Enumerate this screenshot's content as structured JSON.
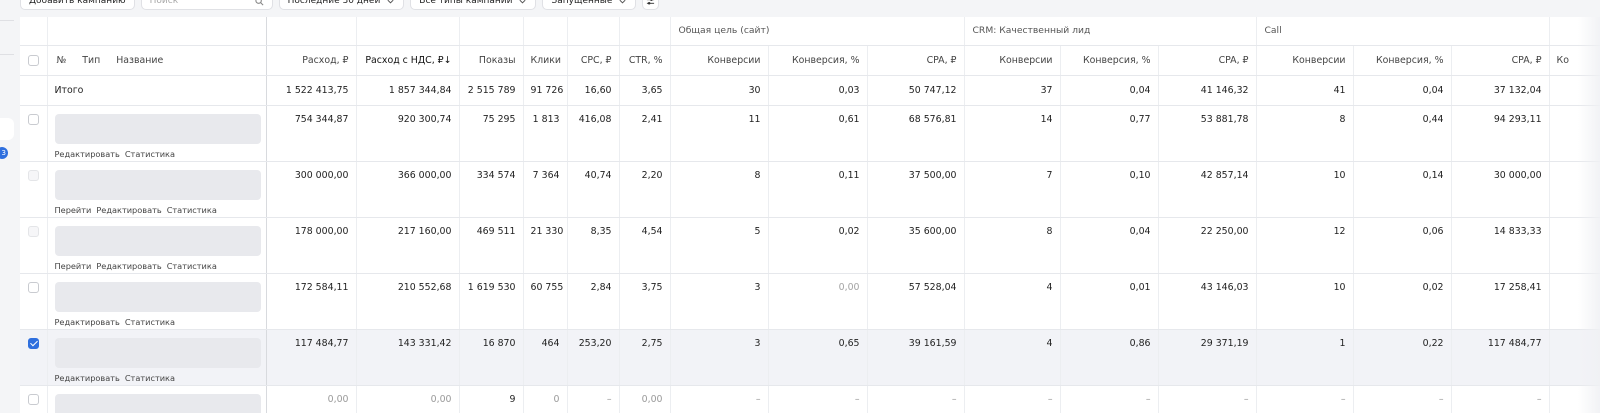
{
  "toolbar": {
    "add_campaign": "Добавить кампанию",
    "search_placeholder": "Поиск",
    "period": "Последние 30 дней",
    "types": "Все типы кампаний",
    "status": "Запущенные"
  },
  "rail": {
    "badge": "3"
  },
  "groups": {
    "goal_site": "Общая цель (сайт)",
    "crm_lead": "CRM: Качественный лид",
    "call": "Call"
  },
  "columns": {
    "num": "№",
    "type": "Тип",
    "name": "Название",
    "spend": "Расход, ₽",
    "spend_vat": "Расход с НДС, ₽↓",
    "impressions": "Показы",
    "clicks": "Клики",
    "cpc": "CPC, ₽",
    "ctr": "CTR, %",
    "conversions": "Конверсии",
    "conv_rate": "Конверсия, %",
    "cpa": "CPA, ₽",
    "more": "Ко"
  },
  "total": {
    "label": "Итого",
    "values": [
      "1 522 413,75",
      "1 857 344,84",
      "2 515 789",
      "91 726",
      "16,60",
      "3,65",
      "30",
      "0,03",
      "50 747,12",
      "37",
      "0,04",
      "41 146,32",
      "41",
      "0,04",
      "37 132,04"
    ]
  },
  "rows": [
    {
      "links": [
        "Редактировать",
        "Статистика"
      ],
      "values": [
        "754 344,87",
        "920 300,74",
        "75 295",
        "1 813",
        "416,08",
        "2,41",
        "11",
        "0,61",
        "68 576,81",
        "14",
        "0,77",
        "53 881,78",
        "8",
        "0,44",
        "94 293,11"
      ]
    },
    {
      "links": [
        "Перейти",
        "Редактировать",
        "Статистика"
      ],
      "values": [
        "300 000,00",
        "366 000,00",
        "334 574",
        "7 364",
        "40,74",
        "2,20",
        "8",
        "0,11",
        "37 500,00",
        "7",
        "0,10",
        "42 857,14",
        "10",
        "0,14",
        "30 000,00"
      ]
    },
    {
      "links": [
        "Перейти",
        "Редактировать",
        "Статистика"
      ],
      "values": [
        "178 000,00",
        "217 160,00",
        "469 511",
        "21 330",
        "8,35",
        "4,54",
        "5",
        "0,02",
        "35 600,00",
        "8",
        "0,04",
        "22 250,00",
        "12",
        "0,06",
        "14 833,33"
      ]
    },
    {
      "links": [
        "Редактировать",
        "Статистика"
      ],
      "values": [
        "172 584,11",
        "210 552,68",
        "1 619 530",
        "60 755",
        "2,84",
        "3,75",
        "3",
        "0,00",
        "57 528,04",
        "4",
        "0,01",
        "43 146,03",
        "10",
        "0,02",
        "17 258,41"
      ]
    },
    {
      "links": [
        "Редактировать",
        "Статистика"
      ],
      "values": [
        "117 484,77",
        "143 331,42",
        "16 870",
        "464",
        "253,20",
        "2,75",
        "3",
        "0,65",
        "39 161,59",
        "4",
        "0,86",
        "29 371,19",
        "1",
        "0,22",
        "117 484,77"
      ]
    },
    {
      "links": [],
      "values": [
        "0,00",
        "0,00",
        "9",
        "0",
        "–",
        "0,00",
        "–",
        "–",
        "–",
        "–",
        "–",
        "–",
        "–",
        "–",
        "–"
      ]
    }
  ]
}
